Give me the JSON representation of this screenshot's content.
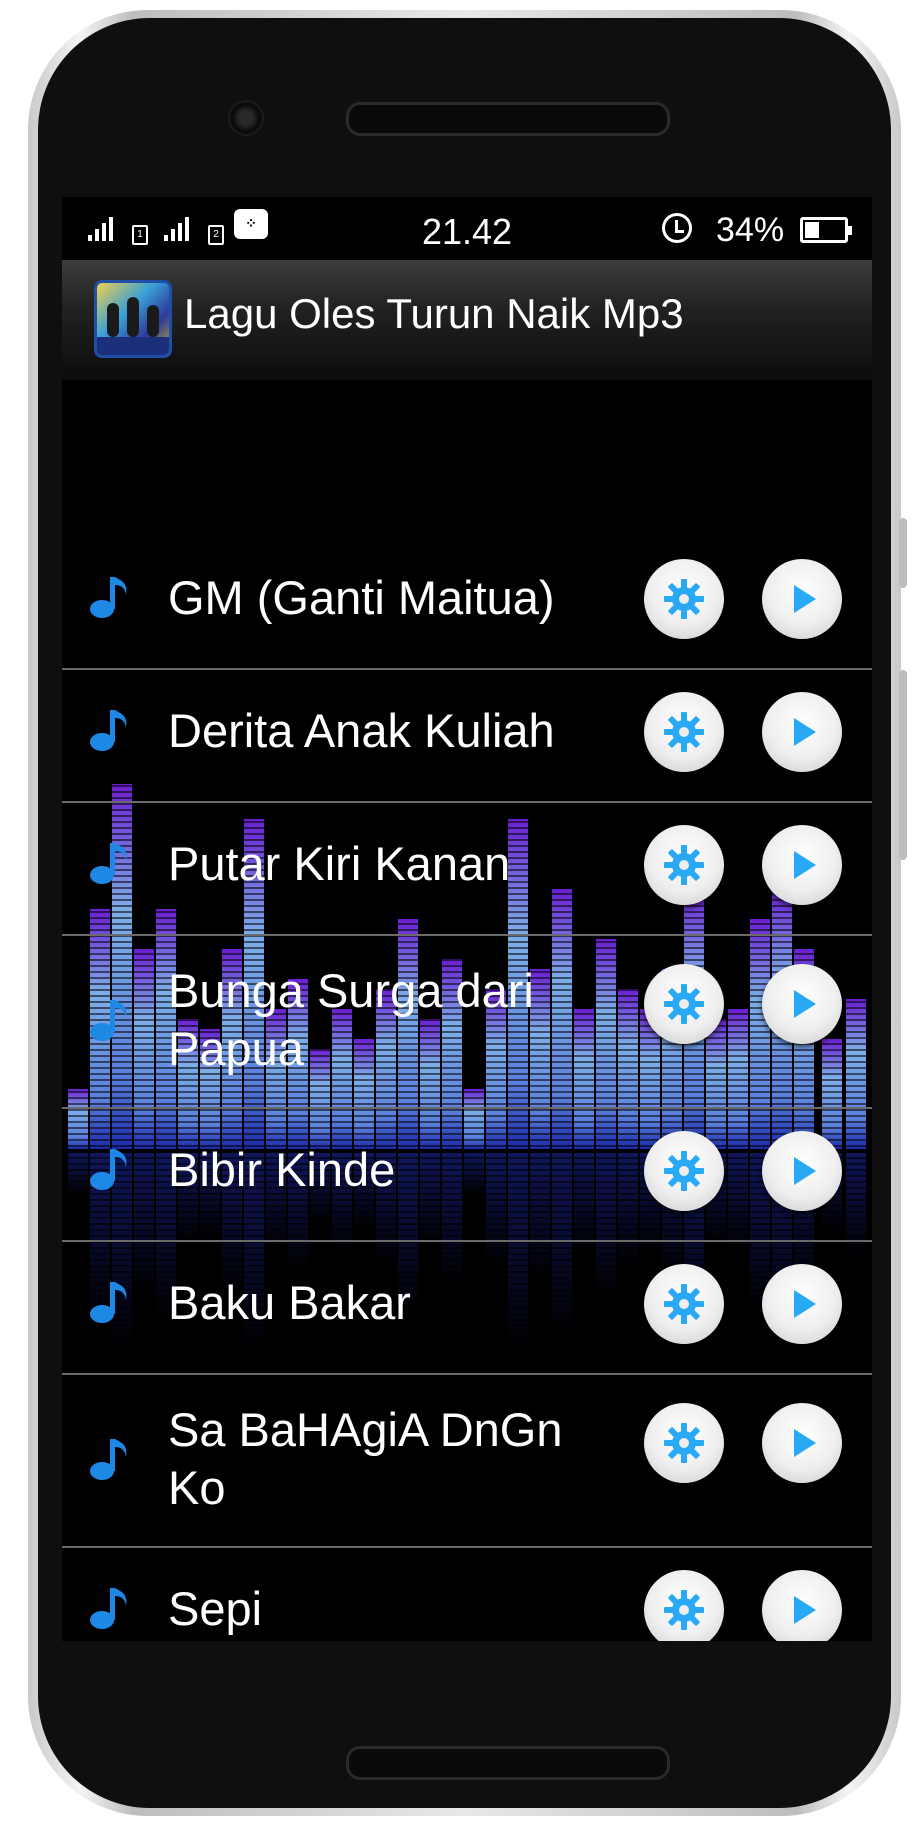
{
  "status_bar": {
    "time": "21.42",
    "battery": "34%",
    "battery_level": 0.34,
    "sim1": "1",
    "sim2": "2",
    "icons": [
      "signal-icon",
      "sim1-icon",
      "signal-icon",
      "sim2-icon",
      "bbm-icon",
      "alarm-icon",
      "battery-icon"
    ]
  },
  "app_bar": {
    "title": "Lagu Oles Turun Naik Mp3",
    "icon": "app-logo-icon"
  },
  "colors": {
    "note": "#1e88e5",
    "gear": "#29a8f5",
    "play": "#29a8f5",
    "divider": "#6a6a6a",
    "equalizer_top": "#6a1fd0",
    "equalizer_mid": "#7eaee8",
    "equalizer_bottom": "#1c2aa8"
  },
  "songs": [
    {
      "title": "GM (Ganti Maitua)"
    },
    {
      "title": "Derita Anak Kuliah"
    },
    {
      "title": "Putar Kiri Kanan"
    },
    {
      "title": "Bunga Surga dari Papua"
    },
    {
      "title": "Bibir Kinde"
    },
    {
      "title": "Baku Bakar"
    },
    {
      "title": "Sa BaHAgiA DnGn Ko"
    },
    {
      "title": "Sepi"
    }
  ]
}
